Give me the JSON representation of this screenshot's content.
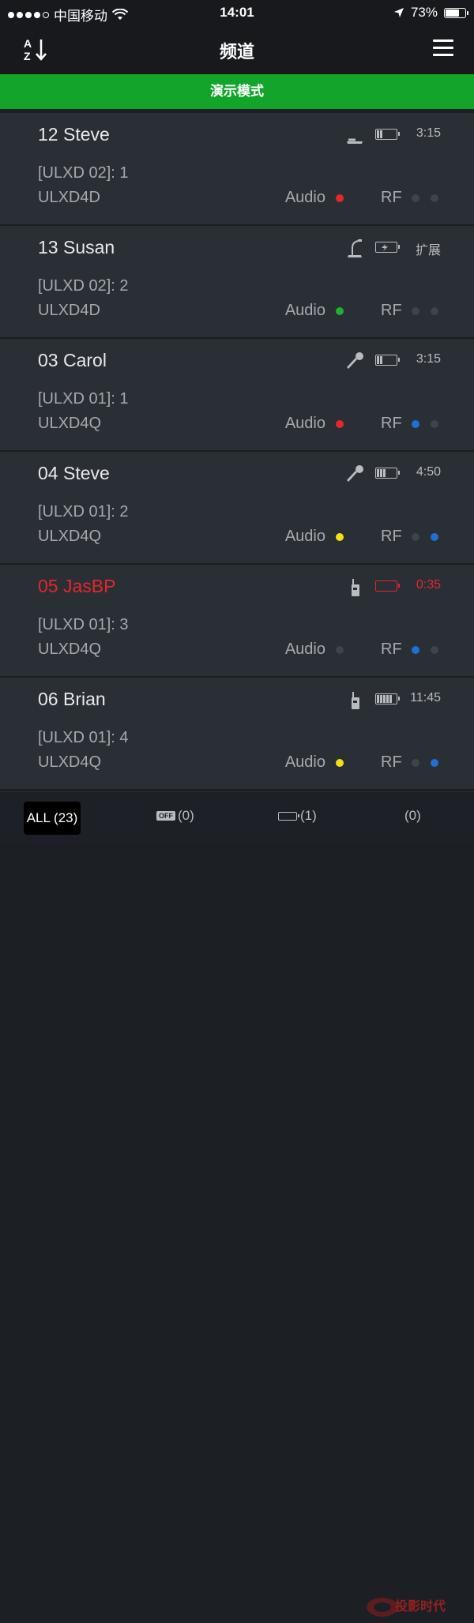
{
  "status_bar": {
    "carrier": "中国移动",
    "time": "14:01",
    "battery": "73%",
    "battery_level": 0.73
  },
  "nav": {
    "title": "频道",
    "sort_icon": "sort-az-icon",
    "menu_icon": "hamburger-menu-icon"
  },
  "banner": {
    "text": "演示模式"
  },
  "colors": {
    "red": "#e4272b",
    "green": "#18b331",
    "yellow": "#f2e01b",
    "blue": "#1f6fd6",
    "off": "#3f434a",
    "banner": "#13a52b"
  },
  "channels": [
    {
      "name": "12 Steve",
      "receiver": "[ULXD 02]: 1",
      "model": "ULXD4D",
      "transmitter_icon": "tabletop-gooseneck-icon",
      "battery_bars": 2,
      "time": "3:15",
      "audio_label": "Audio",
      "audio_color": "#e4272b",
      "rf_label": "RF",
      "rf_a": "#3f434a",
      "rf_b": "#3f434a",
      "alert": false
    },
    {
      "name": "13 Susan",
      "receiver": "[ULXD 02]: 2",
      "model": "ULXD4D",
      "transmitter_icon": "gooseneck-mic-icon",
      "battery_bars": 0,
      "battery_charging": true,
      "time": "扩展",
      "audio_label": "Audio",
      "audio_color": "#18b331",
      "rf_label": "RF",
      "rf_a": "#3f434a",
      "rf_b": "#3f434a",
      "alert": false
    },
    {
      "name": "03 Carol",
      "receiver": "[ULXD 01]: 1",
      "model": "ULXD4Q",
      "transmitter_icon": "handheld-mic-icon",
      "battery_bars": 2,
      "time": "3:15",
      "audio_label": "Audio",
      "audio_color": "#e4272b",
      "rf_label": "RF",
      "rf_a": "#1f6fd6",
      "rf_b": "#3f434a",
      "alert": false
    },
    {
      "name": "04 Steve",
      "receiver": "[ULXD 01]: 2",
      "model": "ULXD4Q",
      "transmitter_icon": "handheld-mic-icon",
      "battery_bars": 3,
      "time": "4:50",
      "audio_label": "Audio",
      "audio_color": "#f2e01b",
      "rf_label": "RF",
      "rf_a": "#3f434a",
      "rf_b": "#1f6fd6",
      "alert": false
    },
    {
      "name": "05 JasBP",
      "receiver": "[ULXD 01]: 3",
      "model": "ULXD4Q",
      "transmitter_icon": "bodypack-icon",
      "battery_bars": 0,
      "time": "0:35",
      "audio_label": "Audio",
      "audio_color": "#3f434a",
      "rf_label": "RF",
      "rf_a": "#1f6fd6",
      "rf_b": "#3f434a",
      "alert": true
    },
    {
      "name": "06 Brian",
      "receiver": "[ULXD 01]: 4",
      "model": "ULXD4Q",
      "transmitter_icon": "bodypack-icon",
      "battery_bars": 5,
      "time": "11:45",
      "audio_label": "Audio",
      "audio_color": "#f2e01b",
      "rf_label": "RF",
      "rf_a": "#3f434a",
      "rf_b": "#1f6fd6",
      "alert": false
    }
  ],
  "tabs": {
    "all": "ALL (23)",
    "off_badge": "OFF",
    "off_count": "(0)",
    "battery_count": "(1)",
    "last_count": "(0)"
  },
  "watermark": {
    "text": "投影时代"
  }
}
